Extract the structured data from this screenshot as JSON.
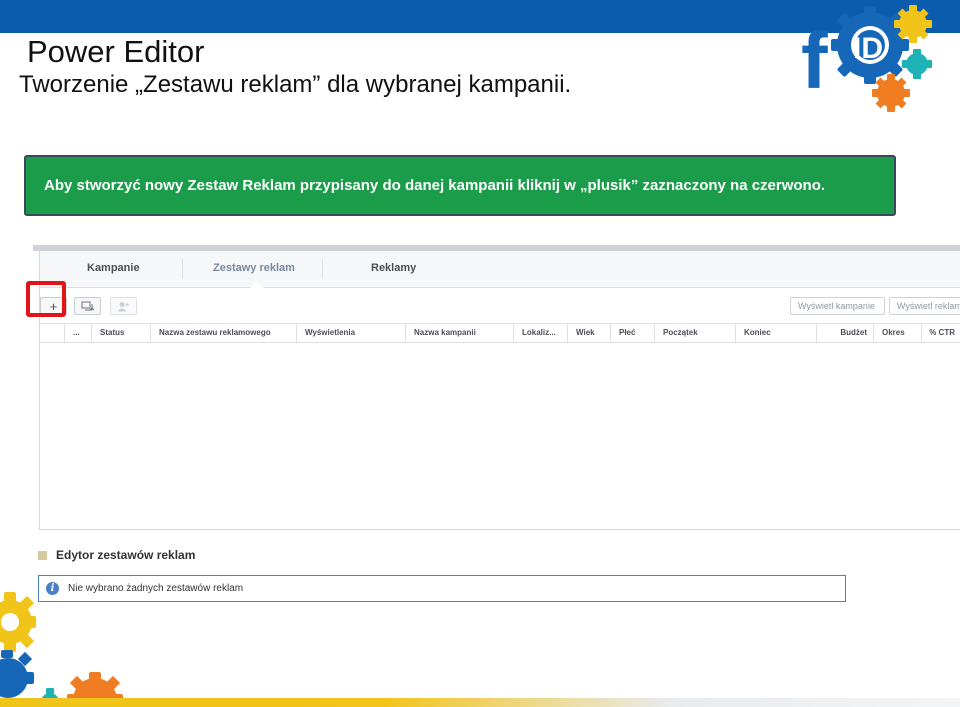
{
  "slide": {
    "title": "Power Editor",
    "subtitle": "Tworzenie „Zestawu reklam” dla wybranej kampanii.",
    "callout": "Aby stworzyć nowy Zestaw Reklam przypisany do danej kampanii kliknij w „plusik” zaznaczony na czerwono.",
    "logo_letters": "f ID"
  },
  "colors": {
    "topbar": "#0b5cad",
    "callout_bg": "#1a9c4a",
    "highlight": "#e1141a",
    "gear_yellow": "#f0c419",
    "gear_teal": "#1fb3b8",
    "gear_orange": "#f07d22",
    "gear_blue": "#1767b9"
  },
  "app": {
    "tabs": {
      "campaigns": "Kampanie",
      "adsets": "Zestawy reklam",
      "ads": "Reklamy"
    },
    "toolbar": {
      "add": "+",
      "duplicate_icon": "duplicate-icon",
      "audience_icon": "audience-icon",
      "show_campaigns": "Wyświetl kampanie",
      "show_ads": "Wyświetl reklamy"
    },
    "columns": {
      "more": "...",
      "status": "Status",
      "adset_name": "Nazwa zestawu reklamowego",
      "impressions": "Wyświetlenia",
      "campaign_name": "Nazwa kampanii",
      "location": "Lokaliz...",
      "age": "Wiek",
      "gender": "Płeć",
      "start": "Początek",
      "end": "Koniec",
      "budget": "Budżet",
      "period": "Okres",
      "ctr": "% CTR"
    },
    "editor": {
      "title": "Edytor zestawów reklam",
      "info_icon": "i",
      "message": "Nie wybrano żadnych zestawów reklam"
    }
  }
}
